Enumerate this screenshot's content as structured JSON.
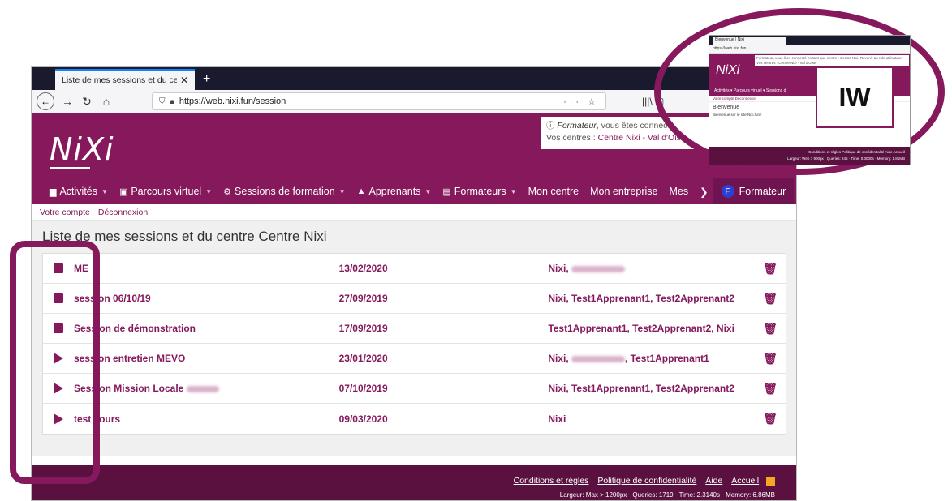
{
  "browser": {
    "tab_title": "Liste de mes sessions et du centre C",
    "url": "https://web.nixi.fun/session"
  },
  "site": {
    "logo": "NiXi",
    "notice_role": "Formateur",
    "notice_text": ", vous êtes connecté",
    "notice_centres_label": "Vos centres : ",
    "notice_centre": "Centre Nixi - Val d'Ois"
  },
  "menu": {
    "items": [
      {
        "label": "Activités",
        "icon": "file-icon"
      },
      {
        "label": "Parcours virtuel",
        "icon": "image-icon"
      },
      {
        "label": "Sessions de formation",
        "icon": "gear-icon"
      },
      {
        "label": "Apprenants",
        "icon": "graduation-cap-icon"
      },
      {
        "label": "Formateurs",
        "icon": "board-icon"
      }
    ],
    "mon_centre": "Mon centre",
    "mon_entreprise": "Mon entreprise",
    "mes": "Mes",
    "user_initial": "F",
    "user_label": "Formateur"
  },
  "account": {
    "votre_compte": "Votre compte",
    "deconnexion": "Déconnexion"
  },
  "main": {
    "title": "Liste de mes sessions et du centre Centre Nixi",
    "sessions": [
      {
        "status": "stop",
        "name": "ME",
        "date": "13/02/2020",
        "members": "Nixi,",
        "blur_after": true
      },
      {
        "status": "stop",
        "name": "session 06/10/19",
        "date": "27/09/2019",
        "members": "Nixi, Test1Apprenant1, Test2Apprenant2"
      },
      {
        "status": "stop",
        "name": "Session de démonstration",
        "date": "17/09/2019",
        "members": "Test1Apprenant1, Test2Apprenant2, Nixi"
      },
      {
        "status": "play",
        "name": "session entretien MEVO",
        "date": "23/01/2020",
        "members": "Nixi,",
        "members_after": ", Test1Apprenant1"
      },
      {
        "status": "play",
        "name": "Session Mission Locale",
        "date": "07/10/2019",
        "members": "Nixi, Test1Apprenant1, Test2Apprenant2"
      },
      {
        "status": "play",
        "name": "test Tours",
        "date": "09/03/2020",
        "members": "Nixi"
      }
    ]
  },
  "footer": {
    "links": [
      "Conditions et règles",
      "Politique de confidentialité",
      "Aide",
      "Accueil"
    ],
    "info": "Largeur: Max > 1200px · Queries: 1719 · Time: 2.3140s · Memory: 6.86MB"
  },
  "thumbnail": {
    "tab_title": "Bienvenue | Nixi",
    "url": "https://web.nixi.fun",
    "logo": "NiXi",
    "notice": "Formateur, vous êtes connecté en tant que centre : Centre Nixi. Revenir au rôle utilisateur. Vos centres : Centre Nixi - Val d'Oise",
    "menu": "Activités ▾   Parcours virtuel ▾   Sessions d",
    "links": "Votre compte   Déconnexion",
    "title": "Bienvenue",
    "text": "Bienvenue sur le site Nixi.fun !",
    "footer_links": "Conditions et règles   Politique de confidentialité   Aide   Accueil",
    "footer_info": "Largeur: Web > 900px · Queries: 245 · Time: 0.0000s · Memory: 1.81MB",
    "badge": "IW"
  },
  "colors": {
    "brand": "#85195c",
    "footer": "#5a1140"
  }
}
